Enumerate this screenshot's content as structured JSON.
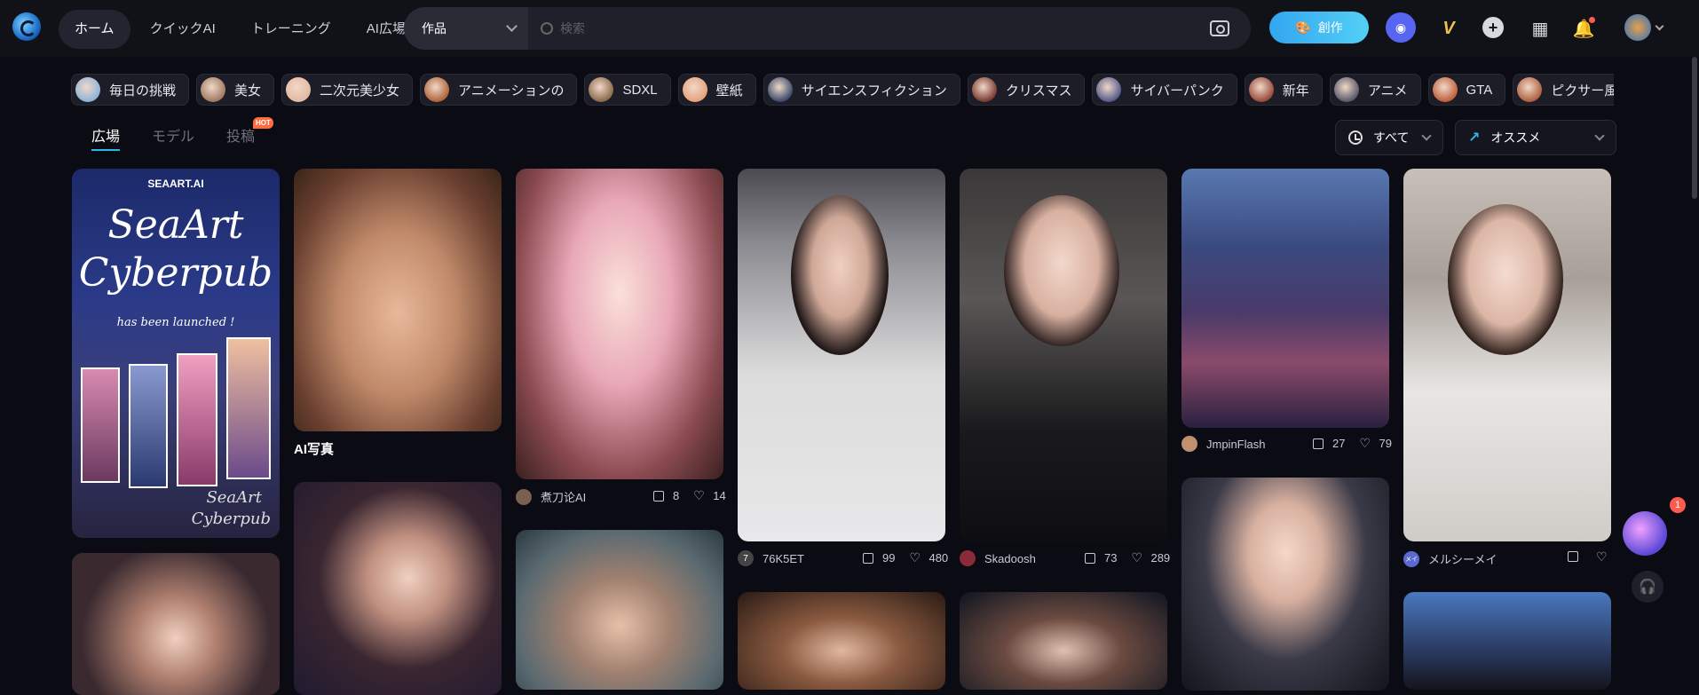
{
  "header": {
    "nav": [
      "ホーム",
      "クイックAI",
      "トレーニング",
      "AI広場"
    ],
    "search_category": "作品",
    "search_placeholder": "検索",
    "create_label": "創作"
  },
  "chips": [
    {
      "label": "毎日の挑戦",
      "color": "#8fb3d9"
    },
    {
      "label": "美女",
      "color": "#a07a60"
    },
    {
      "label": "二次元美少女",
      "color": "#e3b8a0"
    },
    {
      "label": "アニメーションの",
      "color": "#b0643a"
    },
    {
      "label": "SDXL",
      "color": "#8a6a4a"
    },
    {
      "label": "壁紙",
      "color": "#e6a27a"
    },
    {
      "label": "サイエンスフィクション",
      "color": "#3b4a6b"
    },
    {
      "label": "クリスマス",
      "color": "#7a3b30"
    },
    {
      "label": "サイバーパンク",
      "color": "#545c8a"
    },
    {
      "label": "新年",
      "color": "#9a4a3a"
    },
    {
      "label": "アニメ",
      "color": "#5a5a6a"
    },
    {
      "label": "GTA",
      "color": "#c0603a"
    },
    {
      "label": "ピクサー風",
      "color": "#b06040"
    }
  ],
  "tabs": [
    "広場",
    "モデル",
    "投稿"
  ],
  "tab_badge": "HOT",
  "filters": {
    "time": "すべて",
    "sort": "オススメ"
  },
  "cards": {
    "banner": {
      "brand": "SEAART.AI",
      "title1": "SeaArt",
      "title2": "Cyberpub",
      "subtitle": "has been launched !",
      "sign1": "SeaArt",
      "sign2": "Cyberpub"
    },
    "ai_photo_title": "AI写真",
    "fairy": {
      "author": "煮刀论AI",
      "likes": "8",
      "hearts": "14"
    },
    "city_girl": {
      "author_initial": "7",
      "author": "76K5ET",
      "likes": "99",
      "hearts": "480"
    },
    "black_top": {
      "author": "Skadoosh",
      "likes": "73",
      "hearts": "289"
    },
    "cyber_city": {
      "author": "JmpinFlash",
      "likes": "27",
      "hearts": "79"
    },
    "sweater": {
      "author_initial": "メイ",
      "author": "メルシーメイ"
    }
  },
  "float_badge": "1"
}
